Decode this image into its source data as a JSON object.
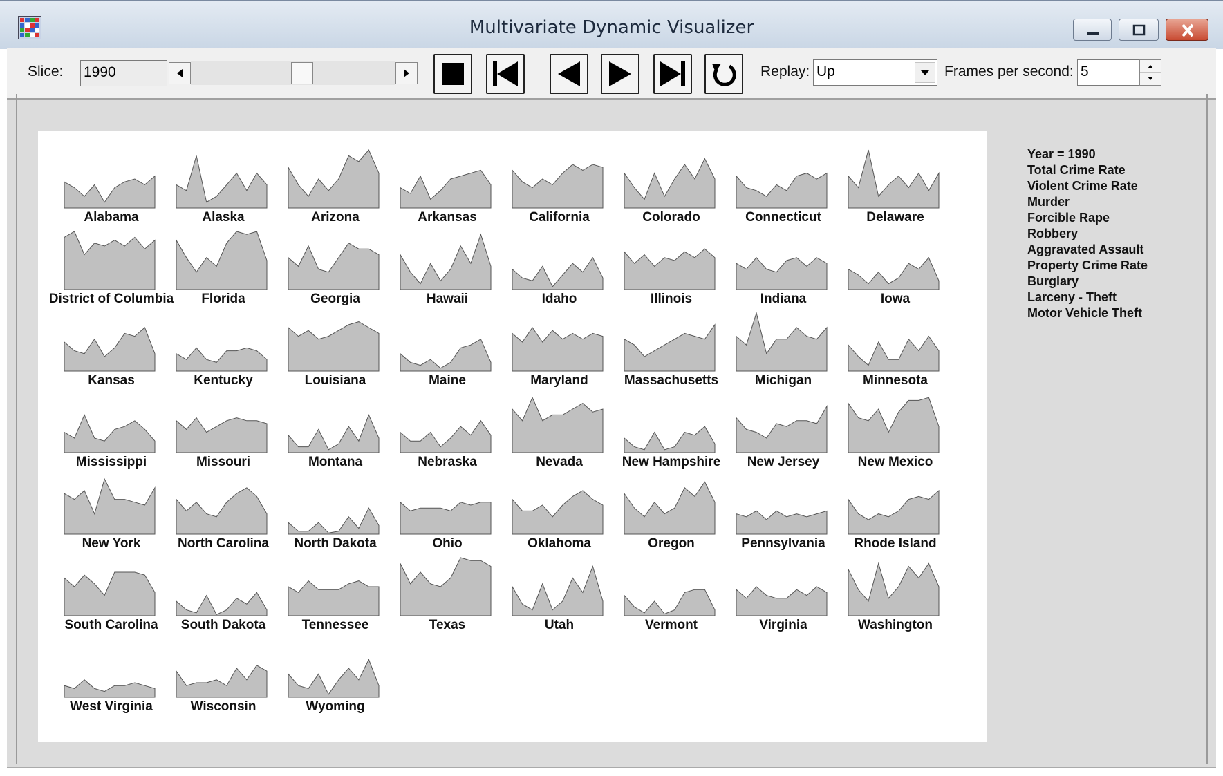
{
  "window": {
    "title": "Multivariate Dynamic Visualizer"
  },
  "toolbar": {
    "slice_label": "Slice:",
    "slice_value": "1990",
    "transport": [
      "stop",
      "first",
      "previous",
      "next",
      "last",
      "replay"
    ],
    "replay_label": "Replay:",
    "replay_value": "Up",
    "fps_label": "Frames per second:",
    "fps_value": "5"
  },
  "legend": {
    "lines": [
      "Year = 1990",
      "Total Crime Rate",
      "Violent Crime Rate",
      "Murder",
      "Forcible Rape",
      "Robbery",
      "Aggravated Assault",
      "Property Crime Rate",
      "Burglary",
      "Larceny - Theft",
      "Motor Vehicle Theft"
    ]
  },
  "colors": {
    "profile_fill": "#c0c0c0",
    "profile_stroke": "#555555",
    "panel_bg": "#dcdcdc"
  },
  "chart_data": {
    "type": "area",
    "title": "Year = 1990",
    "x": [
      "Total Crime Rate",
      "Violent Crime Rate",
      "Murder",
      "Forcible Rape",
      "Robbery",
      "Aggravated Assault",
      "Property Crime Rate",
      "Burglary",
      "Larceny - Theft",
      "Motor Vehicle Theft"
    ],
    "ylim": [
      0,
      1
    ],
    "series": [
      {
        "name": "Alabama",
        "values": [
          0.45,
          0.35,
          0.2,
          0.4,
          0.1,
          0.35,
          0.45,
          0.5,
          0.4,
          0.55
        ]
      },
      {
        "name": "Alaska",
        "values": [
          0.4,
          0.3,
          0.9,
          0.1,
          0.2,
          0.4,
          0.6,
          0.3,
          0.6,
          0.4
        ]
      },
      {
        "name": "Arizona",
        "values": [
          0.7,
          0.4,
          0.2,
          0.5,
          0.3,
          0.5,
          0.9,
          0.8,
          1.0,
          0.6
        ]
      },
      {
        "name": "Arkansas",
        "values": [
          0.35,
          0.25,
          0.55,
          0.15,
          0.3,
          0.5,
          0.55,
          0.6,
          0.65,
          0.4
        ]
      },
      {
        "name": "California",
        "values": [
          0.65,
          0.45,
          0.35,
          0.5,
          0.4,
          0.6,
          0.75,
          0.65,
          0.75,
          0.7
        ]
      },
      {
        "name": "Colorado",
        "values": [
          0.6,
          0.35,
          0.15,
          0.6,
          0.2,
          0.5,
          0.75,
          0.5,
          0.85,
          0.5
        ]
      },
      {
        "name": "Connecticut",
        "values": [
          0.55,
          0.35,
          0.3,
          0.2,
          0.4,
          0.3,
          0.55,
          0.6,
          0.5,
          0.6
        ]
      },
      {
        "name": "Delaware",
        "values": [
          0.55,
          0.35,
          1.0,
          0.2,
          0.4,
          0.55,
          0.35,
          0.6,
          0.3,
          0.6
        ]
      },
      {
        "name": "District of Columbia",
        "values": [
          0.9,
          1.0,
          0.6,
          0.8,
          0.75,
          0.85,
          0.75,
          0.9,
          0.7,
          0.85
        ]
      },
      {
        "name": "Florida",
        "values": [
          0.85,
          0.55,
          0.3,
          0.55,
          0.4,
          0.8,
          1.0,
          0.95,
          1.0,
          0.5
        ]
      },
      {
        "name": "Georgia",
        "values": [
          0.55,
          0.4,
          0.75,
          0.35,
          0.3,
          0.55,
          0.8,
          0.7,
          0.7,
          0.6
        ]
      },
      {
        "name": "Hawaii",
        "values": [
          0.6,
          0.3,
          0.1,
          0.45,
          0.15,
          0.35,
          0.75,
          0.45,
          0.95,
          0.4
        ]
      },
      {
        "name": "Idaho",
        "values": [
          0.35,
          0.2,
          0.15,
          0.4,
          0.05,
          0.25,
          0.45,
          0.3,
          0.55,
          0.2
        ]
      },
      {
        "name": "Illinois",
        "values": [
          0.65,
          0.45,
          0.6,
          0.4,
          0.55,
          0.5,
          0.65,
          0.55,
          0.7,
          0.55
        ]
      },
      {
        "name": "Indiana",
        "values": [
          0.45,
          0.35,
          0.55,
          0.35,
          0.3,
          0.5,
          0.55,
          0.4,
          0.55,
          0.45
        ]
      },
      {
        "name": "Iowa",
        "values": [
          0.35,
          0.25,
          0.1,
          0.3,
          0.1,
          0.2,
          0.45,
          0.35,
          0.55,
          0.15
        ]
      },
      {
        "name": "Kansas",
        "values": [
          0.5,
          0.35,
          0.3,
          0.55,
          0.25,
          0.4,
          0.65,
          0.6,
          0.75,
          0.3
        ]
      },
      {
        "name": "Kentucky",
        "values": [
          0.3,
          0.2,
          0.4,
          0.2,
          0.15,
          0.35,
          0.35,
          0.4,
          0.35,
          0.2
        ]
      },
      {
        "name": "Louisiana",
        "values": [
          0.75,
          0.6,
          0.7,
          0.55,
          0.6,
          0.7,
          0.8,
          0.85,
          0.75,
          0.65
        ]
      },
      {
        "name": "Maine",
        "values": [
          0.3,
          0.15,
          0.1,
          0.2,
          0.05,
          0.15,
          0.4,
          0.45,
          0.55,
          0.15
        ]
      },
      {
        "name": "Maryland",
        "values": [
          0.65,
          0.5,
          0.75,
          0.5,
          0.7,
          0.55,
          0.65,
          0.55,
          0.65,
          0.6
        ]
      },
      {
        "name": "Massachusetts",
        "values": [
          0.55,
          0.45,
          0.25,
          0.35,
          0.45,
          0.55,
          0.65,
          0.6,
          0.55,
          0.8
        ]
      },
      {
        "name": "Michigan",
        "values": [
          0.6,
          0.45,
          1.0,
          0.3,
          0.55,
          0.55,
          0.75,
          0.6,
          0.55,
          0.75
        ]
      },
      {
        "name": "Minnesota",
        "values": [
          0.45,
          0.25,
          0.1,
          0.5,
          0.2,
          0.2,
          0.55,
          0.35,
          0.6,
          0.35
        ]
      },
      {
        "name": "Mississippi",
        "values": [
          0.35,
          0.25,
          0.65,
          0.25,
          0.2,
          0.4,
          0.45,
          0.55,
          0.4,
          0.2
        ]
      },
      {
        "name": "Missouri",
        "values": [
          0.55,
          0.4,
          0.6,
          0.35,
          0.45,
          0.55,
          0.6,
          0.55,
          0.55,
          0.5
        ]
      },
      {
        "name": "Montana",
        "values": [
          0.3,
          0.1,
          0.1,
          0.4,
          0.05,
          0.15,
          0.45,
          0.2,
          0.65,
          0.25
        ]
      },
      {
        "name": "Nebraska",
        "values": [
          0.35,
          0.2,
          0.2,
          0.35,
          0.1,
          0.25,
          0.45,
          0.3,
          0.55,
          0.3
        ]
      },
      {
        "name": "Nevada",
        "values": [
          0.75,
          0.55,
          0.95,
          0.55,
          0.65,
          0.65,
          0.75,
          0.85,
          0.7,
          0.75
        ]
      },
      {
        "name": "New Hampshire",
        "values": [
          0.25,
          0.1,
          0.05,
          0.35,
          0.05,
          0.1,
          0.35,
          0.3,
          0.45,
          0.15
        ]
      },
      {
        "name": "New Jersey",
        "values": [
          0.6,
          0.4,
          0.35,
          0.25,
          0.5,
          0.45,
          0.55,
          0.55,
          0.5,
          0.8
        ]
      },
      {
        "name": "New Mexico",
        "values": [
          0.85,
          0.6,
          0.55,
          0.75,
          0.35,
          0.7,
          0.9,
          0.9,
          0.95,
          0.45
        ]
      },
      {
        "name": "New York",
        "values": [
          0.7,
          0.6,
          0.75,
          0.35,
          0.95,
          0.6,
          0.6,
          0.55,
          0.5,
          0.8
        ]
      },
      {
        "name": "North Carolina",
        "values": [
          0.6,
          0.4,
          0.55,
          0.35,
          0.3,
          0.55,
          0.7,
          0.8,
          0.65,
          0.35
        ]
      },
      {
        "name": "North Dakota",
        "values": [
          0.2,
          0.05,
          0.05,
          0.2,
          0.02,
          0.05,
          0.3,
          0.1,
          0.45,
          0.15
        ]
      },
      {
        "name": "Ohio",
        "values": [
          0.55,
          0.4,
          0.45,
          0.45,
          0.45,
          0.4,
          0.55,
          0.5,
          0.55,
          0.55
        ]
      },
      {
        "name": "Oklahoma",
        "values": [
          0.6,
          0.4,
          0.4,
          0.5,
          0.3,
          0.5,
          0.65,
          0.75,
          0.6,
          0.5
        ]
      },
      {
        "name": "Oregon",
        "values": [
          0.7,
          0.45,
          0.3,
          0.55,
          0.35,
          0.45,
          0.8,
          0.65,
          0.9,
          0.55
        ]
      },
      {
        "name": "Pennsylvania",
        "values": [
          0.35,
          0.3,
          0.4,
          0.25,
          0.4,
          0.3,
          0.35,
          0.3,
          0.35,
          0.4
        ]
      },
      {
        "name": "Rhode Island",
        "values": [
          0.6,
          0.35,
          0.25,
          0.35,
          0.3,
          0.4,
          0.6,
          0.65,
          0.6,
          0.75
        ]
      },
      {
        "name": "South Carolina",
        "values": [
          0.65,
          0.5,
          0.7,
          0.55,
          0.35,
          0.75,
          0.75,
          0.75,
          0.7,
          0.4
        ]
      },
      {
        "name": "South Dakota",
        "values": [
          0.25,
          0.1,
          0.05,
          0.35,
          0.02,
          0.1,
          0.3,
          0.2,
          0.4,
          0.1
        ]
      },
      {
        "name": "Tennessee",
        "values": [
          0.5,
          0.4,
          0.6,
          0.45,
          0.45,
          0.45,
          0.55,
          0.6,
          0.5,
          0.5
        ]
      },
      {
        "name": "Texas",
        "values": [
          0.9,
          0.55,
          0.75,
          0.55,
          0.5,
          0.65,
          1.0,
          0.95,
          0.95,
          0.85
        ]
      },
      {
        "name": "Utah",
        "values": [
          0.5,
          0.2,
          0.1,
          0.55,
          0.1,
          0.25,
          0.65,
          0.4,
          0.85,
          0.25
        ]
      },
      {
        "name": "Vermont",
        "values": [
          0.35,
          0.15,
          0.05,
          0.25,
          0.03,
          0.1,
          0.4,
          0.45,
          0.45,
          0.1
        ]
      },
      {
        "name": "Virginia",
        "values": [
          0.45,
          0.3,
          0.5,
          0.35,
          0.3,
          0.3,
          0.45,
          0.35,
          0.5,
          0.4
        ]
      },
      {
        "name": "Washington",
        "values": [
          0.8,
          0.45,
          0.25,
          0.9,
          0.3,
          0.5,
          0.85,
          0.65,
          0.9,
          0.5
        ]
      },
      {
        "name": "West Virginia",
        "values": [
          0.2,
          0.15,
          0.3,
          0.15,
          0.1,
          0.2,
          0.2,
          0.25,
          0.2,
          0.15
        ]
      },
      {
        "name": "Wisconsin",
        "values": [
          0.45,
          0.2,
          0.25,
          0.25,
          0.3,
          0.2,
          0.5,
          0.3,
          0.55,
          0.45
        ]
      },
      {
        "name": "Wyoming",
        "values": [
          0.4,
          0.2,
          0.15,
          0.4,
          0.05,
          0.3,
          0.5,
          0.3,
          0.65,
          0.2
        ]
      }
    ]
  }
}
